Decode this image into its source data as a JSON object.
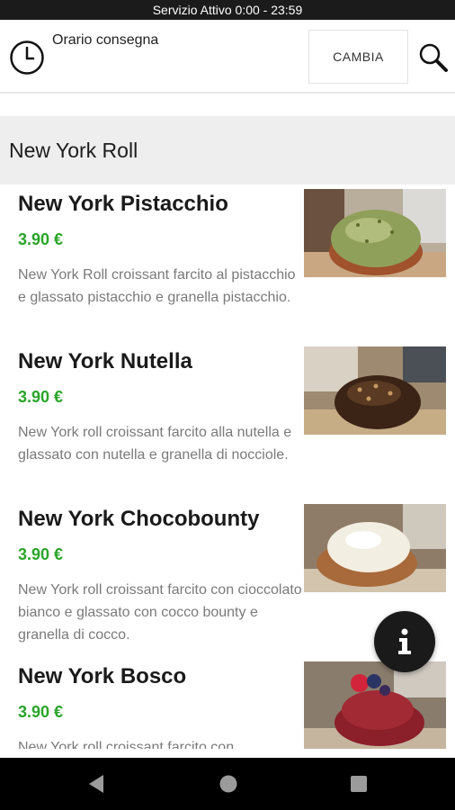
{
  "status_bar": {
    "text": "Servizio Attivo  0:00 - 23:59"
  },
  "header": {
    "delivery_label": "Orario consegna",
    "change_label": "CAMBIA"
  },
  "category": {
    "title": "New York Roll"
  },
  "items": [
    {
      "title": "New York Pistacchio",
      "price": "3.90 €",
      "description": "New York Roll croissant farcito al pistacchio e glassato pistacchio e granella pistacchio.",
      "image_icon": "pistachio-pastry-photo"
    },
    {
      "title": "New York Nutella",
      "price": "3.90 €",
      "description": "New York roll croissant farcito alla nutella e glassato con nutella e granella di nocciole.",
      "image_icon": "nutella-pastry-photo"
    },
    {
      "title": "New York Chocobounty",
      "price": "3.90 €",
      "description": "New York roll croissant farcito con cioccolato bianco e glassato con cocco bounty e granella di cocco.",
      "image_icon": "chocobounty-pastry-photo"
    },
    {
      "title": "New York Bosco",
      "price": "3.90 €",
      "description": "New York roll croissant farcito con",
      "image_icon": "bosco-pastry-photo"
    }
  ],
  "colors": {
    "price": "#2aa52a",
    "status_bar": "#1b1b1b",
    "category_bg": "#eeeeee",
    "fab": "#1a1a1a"
  },
  "icons": [
    "clock-icon",
    "search-icon",
    "info-icon",
    "back-nav-icon",
    "home-nav-icon",
    "recents-nav-icon"
  ]
}
